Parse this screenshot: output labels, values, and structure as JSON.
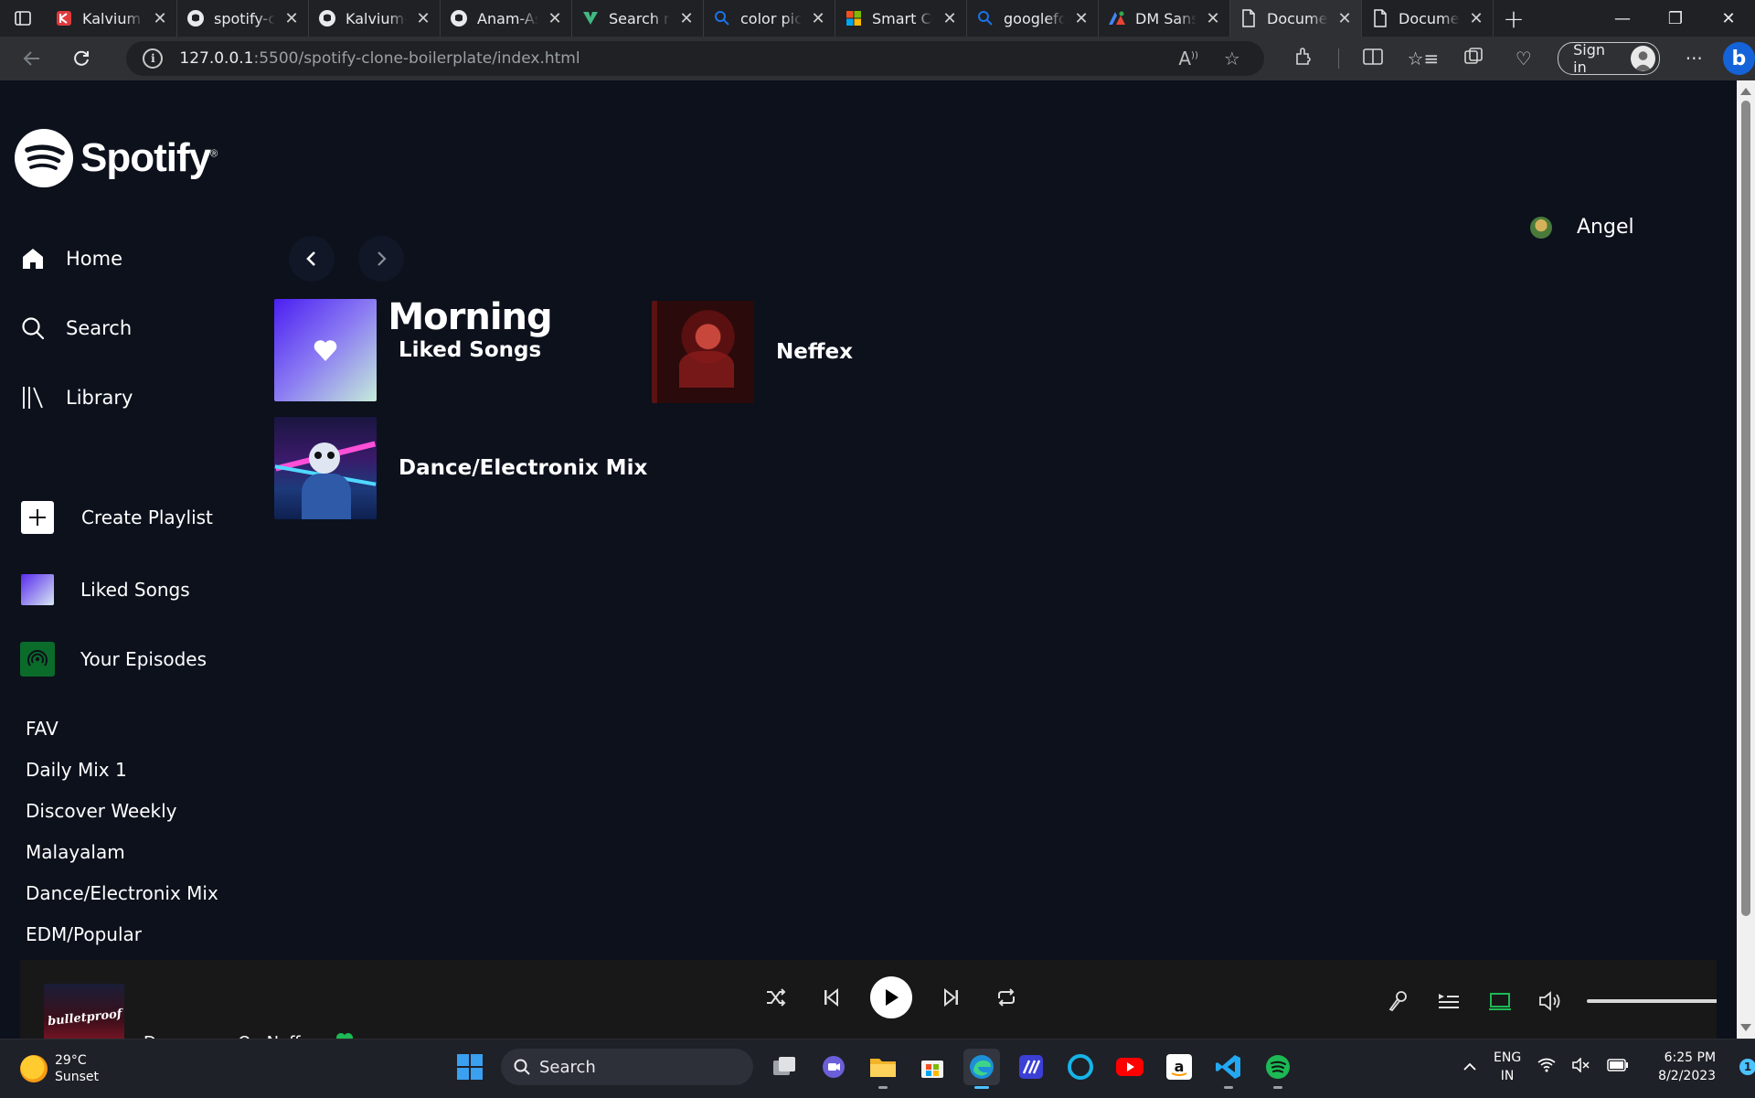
{
  "browser": {
    "tabs": [
      {
        "label": "Kalvium",
        "icon": "kalvium-icon"
      },
      {
        "label": "spotify-clone-boilerplate",
        "icon": "github-icon"
      },
      {
        "label": "Kalvium-Projects",
        "icon": "github-icon"
      },
      {
        "label": "Anam-Asif",
        "icon": "github-icon"
      },
      {
        "label": "Search results",
        "icon": "search-results-icon"
      },
      {
        "label": "color picker",
        "icon": "search-icon"
      },
      {
        "label": "Smart Color",
        "icon": "microsoft-icon"
      },
      {
        "label": "googlefonts",
        "icon": "search-icon"
      },
      {
        "label": "DM Sans",
        "icon": "google-fonts-icon"
      },
      {
        "label": "Document",
        "icon": "document-icon"
      },
      {
        "label": "Document",
        "icon": "document-icon"
      }
    ],
    "url_host": "127.0.0.1",
    "url_path": ":5500/spotify-clone-boilerplate/index.html",
    "signin_label": "Sign in"
  },
  "sidebar": {
    "logo_text": "Spotify",
    "nav": [
      {
        "label": "Home"
      },
      {
        "label": "Search"
      },
      {
        "label": "Library"
      }
    ],
    "actions": [
      {
        "label": "Create Playlist"
      },
      {
        "label": "Liked Songs"
      },
      {
        "label": "Your Episodes"
      }
    ],
    "playlists": [
      "FAV",
      "Daily Mix 1",
      "Discover Weekly",
      "Malayalam",
      "Dance/Electronix Mix",
      "EDM/Popular"
    ]
  },
  "main": {
    "greeting": "Good Morning",
    "user_name": "Angel",
    "cards": [
      {
        "label": "Liked Songs"
      },
      {
        "label": "Neffex"
      },
      {
        "label": "Dance/Electronix Mix"
      }
    ]
  },
  "player": {
    "track_title": "Dangerous On Neffex",
    "art_text": "bulletproof"
  },
  "taskbar": {
    "weather_temp": "29°C",
    "weather_desc": "Sunset",
    "search_label": "Search",
    "lang_line1": "ENG",
    "lang_line2": "IN",
    "time": "6:25 PM",
    "date": "8/2/2023",
    "notification_count": "1"
  },
  "colors": {
    "page_bg": "#0c111c",
    "spotify_green": "#1db954",
    "player_bg": "#181818",
    "episodes_green": "#0b6b2a",
    "liked_gradient_start": "#4b1ff2",
    "liked_gradient_end": "#c5ecd9"
  }
}
